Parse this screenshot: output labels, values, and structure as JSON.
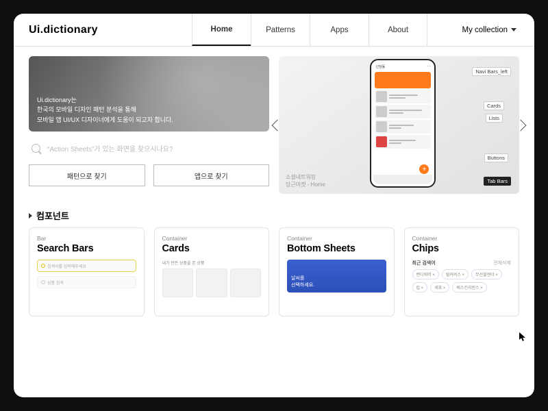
{
  "brand": "Ui.dictionary",
  "nav": {
    "home": "Home",
    "patterns": "Patterns",
    "apps": "Apps",
    "about": "About",
    "mycollection": "My collection"
  },
  "hero": {
    "line1": "Ui.dictionary는",
    "line2": "한국의 모바일 디자인 패턴 분석을 통해",
    "line3": "모바일 앱 UI/UX 디자이너에게 도움이 되고자 합니다.",
    "search_placeholder": "“Action Sheets”가 있는 화면을 찾으시나요?",
    "btn_pattern": "패턴으로 찾기",
    "btn_app": "앱으로 찾기"
  },
  "showcase": {
    "phone_title": "신당동",
    "caption_line1": "소셜네트워킹",
    "caption_line2": "당근마켓 - Home",
    "annot_navbar": "Navi Bars_left",
    "annot_cards": "Cards",
    "annot_lists": "Lists",
    "annot_buttons": "Buttons",
    "annot_tabbars": "Tab Bars"
  },
  "section_components": "컴포넌트",
  "cards": [
    {
      "category": "Bar",
      "title": "Search Bars",
      "mini1": "검색어를 입력해주세요",
      "mini2": "상품 검색"
    },
    {
      "category": "Container",
      "title": "Cards",
      "sub": "내가 만든 상품을 본 상품"
    },
    {
      "category": "Container",
      "title": "Bottom Sheets",
      "sheet1": "날씨를",
      "sheet2": "선택하세요."
    },
    {
      "category": "Container",
      "title": "Chips",
      "head": "최근 검색어",
      "more": "전체삭제",
      "chips": [
        "캔디워머 ×",
        "릴커머스 ×",
        "무선블렌더 ×",
        "립 ×",
        "세포 ×",
        "베스킨라빈스 ×"
      ]
    }
  ]
}
